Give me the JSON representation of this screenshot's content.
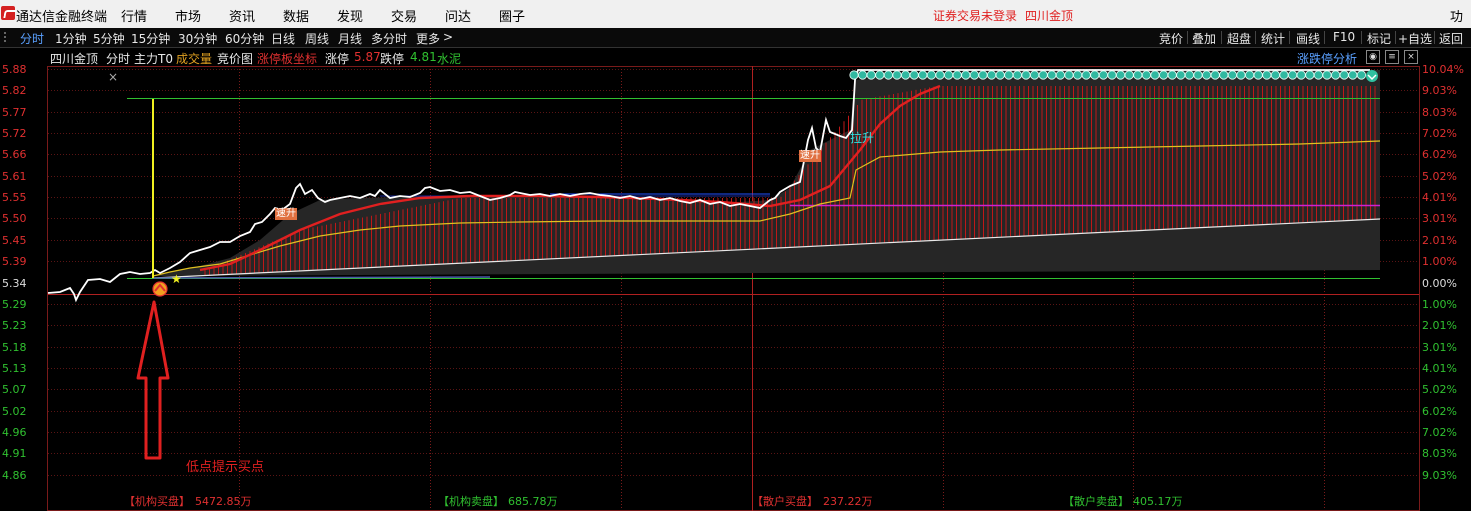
{
  "app": {
    "title": "通达信金融终端",
    "menu": [
      "行情",
      "市场",
      "资讯",
      "数据",
      "发现",
      "交易",
      "问达",
      "圈子"
    ],
    "notice": "证券交易未登录",
    "stock_top": "四川金顶",
    "func": "功能"
  },
  "periods": [
    "分时",
    "1分钟",
    "5分钟",
    "15分钟",
    "30分钟",
    "60分钟",
    "日线",
    "周线",
    "月线",
    "多分时",
    "更多"
  ],
  "right_tabs": [
    "竞价",
    "叠加",
    "超盘",
    "统计",
    "画线",
    "F10",
    "标记",
    "+自选",
    "返回"
  ],
  "info": {
    "stock": "四川金顶",
    "mode": "分时",
    "main": "主力T0",
    "volume": "成交量",
    "bid": "竞价图",
    "limit_coord": "涨停板坐标",
    "limit_up_label": "涨停",
    "limit_up_value": "5.87",
    "limit_down_label": "跌停",
    "limit_down_value": "4.81",
    "sector": "水泥",
    "analysis": "涨跌停分析"
  },
  "price_axis": [
    "5.88",
    "5.82",
    "5.77",
    "5.72",
    "5.66",
    "5.61",
    "5.55",
    "5.50",
    "5.45",
    "5.39",
    "5.34",
    "5.29",
    "5.23",
    "5.18",
    "5.13",
    "5.07",
    "5.02",
    "4.96",
    "4.91",
    "4.86"
  ],
  "pct_axis": [
    "10.04%",
    "9.03%",
    "8.03%",
    "7.02%",
    "6.02%",
    "5.02%",
    "4.01%",
    "3.01%",
    "2.01%",
    "1.00%",
    "0.00%",
    "1.00%",
    "2.01%",
    "3.01%",
    "4.01%",
    "5.02%",
    "6.02%",
    "7.02%",
    "8.03%",
    "9.03%"
  ],
  "chart_labels": {
    "speed_up": "速升",
    "pull_up": "拉升",
    "annotation": "低点提示买点",
    "close_x": "×"
  },
  "stats": {
    "inst_buy_label": "【机构买盘】",
    "inst_buy": "5472.85万",
    "inst_sell_label": "【机构卖盘】",
    "inst_sell": "685.78万",
    "retail_buy_label": "【散户买盘】",
    "retail_buy": "237.22万",
    "retail_sell_label": "【散户卖盘】",
    "retail_sell": "405.17万"
  },
  "colors": {
    "up": "#e03030",
    "down": "#30c030",
    "price_line": "#ffffff",
    "avg_line": "#e0e000",
    "accent": "#5aa0ff"
  }
}
